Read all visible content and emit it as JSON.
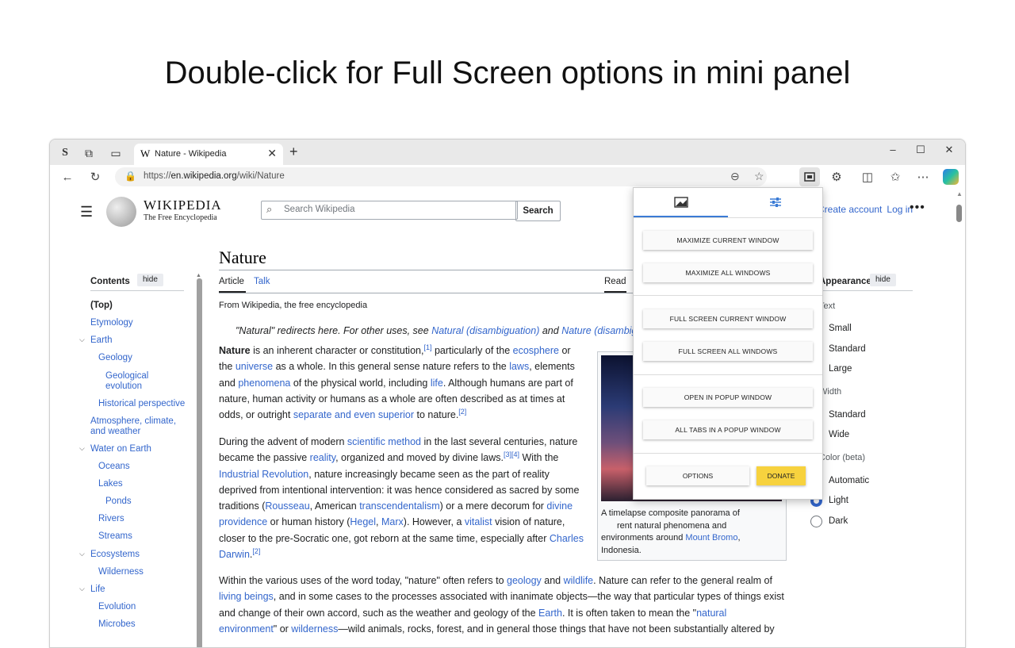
{
  "headline": "Double-click for Full Screen options in mini panel",
  "browser": {
    "tab_title": "Nature - Wikipedia",
    "tab_favicon": "W",
    "new_tab": "+",
    "url_prefix": "https://",
    "url_host": "en.wikipedia.org",
    "url_path": "/wiki/Nature",
    "window_controls": [
      "–",
      "☐",
      "✕"
    ]
  },
  "wiki": {
    "wordmark": "WIKIPEDIA",
    "tagline": "The Free Encyclopedia",
    "search_placeholder": "Search Wikipedia",
    "search_button": "Search",
    "create_account": "Create account",
    "log_in": "Log in",
    "toc": {
      "title": "Contents",
      "hide": "hide",
      "items": [
        "(Top)",
        "Etymology",
        "Earth",
        "Geology",
        "Geological evolution",
        "Historical perspective",
        "Atmosphere, climate, and weather",
        "Water on Earth",
        "Oceans",
        "Lakes",
        "Ponds",
        "Rivers",
        "Streams",
        "Ecosystems",
        "Wilderness",
        "Life",
        "Evolution",
        "Microbes"
      ]
    },
    "article": {
      "title": "Nature",
      "tab_article": "Article",
      "tab_talk": "Talk",
      "tab_read": "Read",
      "from": "From Wikipedia, the free encyclopedia",
      "hatnote": "\"Natural\" redirects here. For other uses, see",
      "hatnote_link1": "Natural (disambiguation)",
      "hatnote_and": "and",
      "hatnote_link2": "Nature (disambiguation)",
      "caption_a": "A timelapse composite panorama of",
      "caption_b": "rent natural phenomena and",
      "caption_c": "environments around",
      "caption_link": "Mount Bromo",
      "caption_d": ", Indonesia."
    },
    "appearance": {
      "title": "Appearance",
      "hide": "hide",
      "text_label": "Text",
      "text_options": [
        "Small",
        "Standard",
        "Large"
      ],
      "width_label": "Width",
      "width_options": [
        "Standard",
        "Wide"
      ],
      "color_label": "Color (beta)",
      "color_options": [
        "Automatic",
        "Light",
        "Dark"
      ],
      "selected_color": "Light"
    }
  },
  "panel": {
    "tabs": [
      "display-icon",
      "sliders-icon"
    ],
    "buttons": [
      "MAXIMIZE CURRENT WINDOW",
      "MAXIMIZE ALL WINDOWS",
      "FULL SCREEN CURRENT WINDOW",
      "FULL SCREEN ALL WINDOWS",
      "OPEN IN POPUP WINDOW",
      "ALL TABS IN A POPUP WINDOW"
    ],
    "options": "OPTIONS",
    "donate": "DONATE",
    "donate_color": "#f7d23e",
    "accent_color": "#3a7bd5"
  }
}
